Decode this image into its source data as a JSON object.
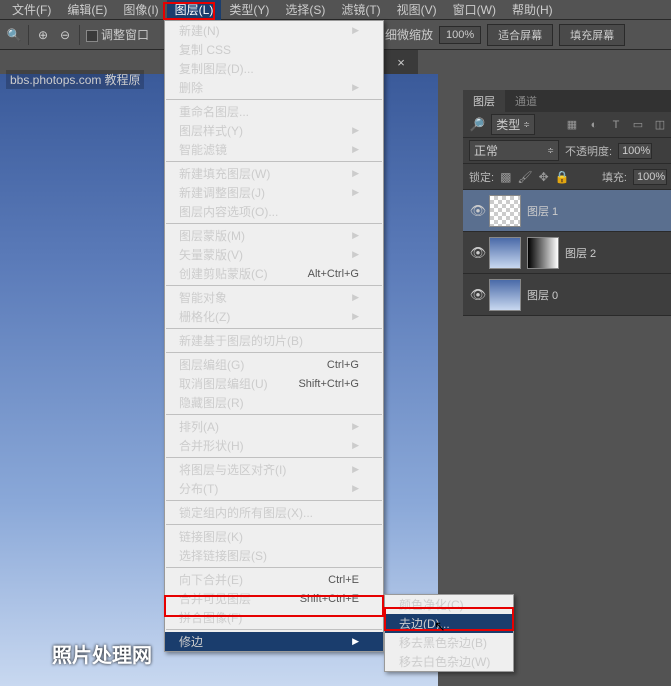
{
  "menubar": {
    "file": "文件(F)",
    "edit": "编辑(E)",
    "image": "图像(I)",
    "layer": "图层(L)",
    "type": "类型(Y)",
    "select": "选择(S)",
    "filter": "滤镜(T)",
    "view": "视图(V)",
    "window": "窗口(W)",
    "help": "帮助(H)"
  },
  "toolbar": {
    "adjust_window": "调整窗口",
    "micro_zoom": "细微缩放",
    "zoom_pct": "100%",
    "fit_screen": "适合屏幕",
    "fill_screen": "填充屏幕"
  },
  "doctab": {
    "ps_icon": "Ps",
    "site": "bbs.photops.com",
    "suffix": "教程原"
  },
  "watermark": "照片处理网",
  "layer_menu": {
    "new": "新建(N)",
    "copy_css": "复制 CSS",
    "dup": "复制图层(D)...",
    "delete": "删除",
    "rename": "重命名图层...",
    "style": "图层样式(Y)",
    "smart_filter": "智能滤镜",
    "new_fill": "新建填充图层(W)",
    "new_adj": "新建调整图层(J)",
    "content_opts": "图层内容选项(O)...",
    "mask": "图层蒙版(M)",
    "vector_mask": "矢量蒙版(V)",
    "clip_mask": "创建剪贴蒙版(C)",
    "clip_sc": "Alt+Ctrl+G",
    "smart_obj": "智能对象",
    "raster": "栅格化(Z)",
    "slice": "新建基于图层的切片(B)",
    "group": "图层编组(G)",
    "group_sc": "Ctrl+G",
    "ungroup": "取消图层编组(U)",
    "ungroup_sc": "Shift+Ctrl+G",
    "hide": "隐藏图层(R)",
    "arrange": "排列(A)",
    "shape": "合并形状(H)",
    "align": "将图层与选区对齐(I)",
    "distribute": "分布(T)",
    "lock_all": "锁定组内的所有图层(X)...",
    "link": "链接图层(K)",
    "select_linked": "选择链接图层(S)",
    "merge_down": "向下合并(E)",
    "merge_down_sc": "Ctrl+E",
    "merge_vis": "合并可见图层",
    "merge_vis_sc": "Shift+Ctrl+E",
    "flatten": "拼合图像(F)",
    "matting": "修边"
  },
  "submenu": {
    "defringe_color": "颜色净化(C)...",
    "defringe": "去边(D)...",
    "black_matte": "移去黑色杂边(B)",
    "white_matte": "移去白色杂边(W)"
  },
  "panels": {
    "tab_layers": "图层",
    "tab_channels": "通道",
    "kind": "类型",
    "blend": "正常",
    "opacity_lbl": "不透明度:",
    "opacity": "100%",
    "lock_lbl": "锁定:",
    "fill_lbl": "填充:",
    "fill": "100%",
    "layer1": "图层 1",
    "layer2": "图层 2",
    "layer0": "图层 0"
  }
}
